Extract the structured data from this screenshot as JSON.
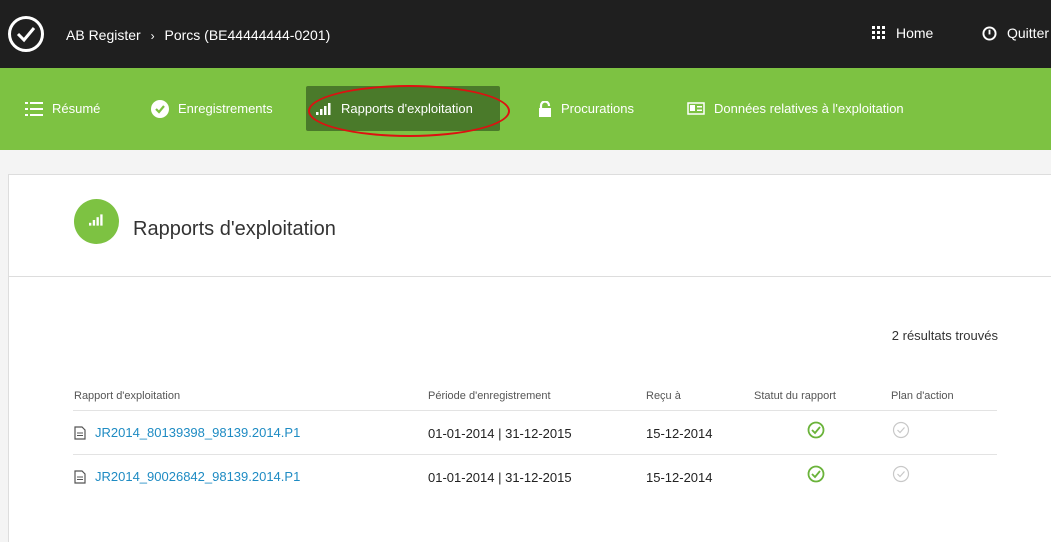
{
  "topbar": {
    "breadcrumb_app": "AB Register",
    "breadcrumb_sep": "›",
    "breadcrumb_current": "Porcs (BE44444444-0201)",
    "home_label": "Home",
    "quit_label": "Quitter"
  },
  "nav": {
    "items": [
      {
        "label": "Résumé",
        "icon": "list-icon"
      },
      {
        "label": "Enregistrements",
        "icon": "check-circle-icon"
      },
      {
        "label": "Rapports d'exploitation",
        "icon": "signal-bars-icon",
        "active": true
      },
      {
        "label": "Procurations",
        "icon": "lock-icon"
      },
      {
        "label": "Données relatives à l'exploitation",
        "icon": "card-icon"
      }
    ]
  },
  "page": {
    "title": "Rapports d'exploitation",
    "results_count": "2 résultats trouvés"
  },
  "table": {
    "headers": [
      "Rapport d'exploitation",
      "Période d'enregistrement",
      "Reçu à",
      "Statut du rapport",
      "Plan d'action"
    ],
    "rows": [
      {
        "report": "JR2014_80139398_98139.2014.P1",
        "period": "01-01-2014 | 31-12-2015",
        "received": "15-12-2014",
        "status": "ok",
        "plan": "inactive"
      },
      {
        "report": "JR2014_90026842_98139.2014.P1",
        "period": "01-01-2014 | 31-12-2015",
        "received": "15-12-2014",
        "status": "ok",
        "plan": "inactive"
      }
    ]
  },
  "colors": {
    "topbar": "#1f1f1f",
    "nav_green": "#7dc242",
    "nav_active": "#4a7a2a",
    "link_blue": "#1e8bc3",
    "status_green": "#6ab33a",
    "annotation_red": "#dd1111"
  }
}
